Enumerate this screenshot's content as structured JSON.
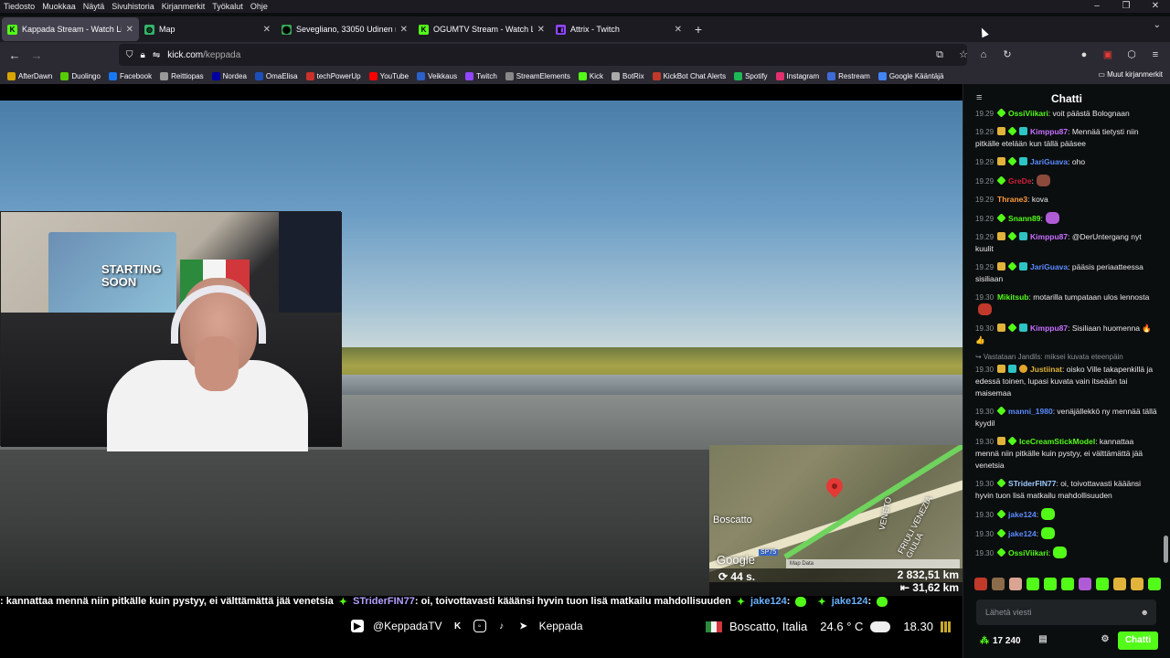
{
  "menubar": [
    "Tiedosto",
    "Muokkaa",
    "Näytä",
    "Sivuhistoria",
    "Kirjanmerkit",
    "Työkalut",
    "Ohje"
  ],
  "tabs": [
    {
      "label": "Kappada Stream - Watch Li",
      "icon": "kick-icon",
      "color": "#53fc18",
      "active": true
    },
    {
      "label": "Map",
      "icon": "globe-icon",
      "color": "#33b36b",
      "active": false
    },
    {
      "label": "Sevegliano, 33050 Udinen maakunta",
      "icon": "map-pin-icon",
      "color": "#34a853",
      "active": false
    },
    {
      "label": "OGUMTV Stream - Watch Li",
      "icon": "kick-icon",
      "color": "#53fc18",
      "active": false
    },
    {
      "label": "Attrix - Twitch",
      "icon": "twitch-icon",
      "color": "#9146ff",
      "active": false
    }
  ],
  "url": {
    "host": "kick.com",
    "path": "/keppada"
  },
  "bookmarks": [
    {
      "label": "AfterDawn",
      "color": "#d9a400"
    },
    {
      "label": "Duolingo",
      "color": "#58cc02"
    },
    {
      "label": "Facebook",
      "color": "#1877f2"
    },
    {
      "label": "Reittiopas",
      "color": "#999999"
    },
    {
      "label": "Nordea",
      "color": "#0000a0"
    },
    {
      "label": "OmaElisa",
      "color": "#1d4fb8"
    },
    {
      "label": "techPowerUp",
      "color": "#c9312a"
    },
    {
      "label": "YouTube",
      "color": "#ff0000"
    },
    {
      "label": "Veikkaus",
      "color": "#2a60c8"
    },
    {
      "label": "Twitch",
      "color": "#9146ff"
    },
    {
      "label": "StreamElements",
      "color": "#888888"
    },
    {
      "label": "Kick",
      "color": "#53fc18"
    },
    {
      "label": "BotRix",
      "color": "#aaaaaa"
    },
    {
      "label": "KickBot Chat Alerts",
      "color": "#c0392b"
    },
    {
      "label": "Spotify",
      "color": "#1db954"
    },
    {
      "label": "Instagram",
      "color": "#e1306c"
    },
    {
      "label": "Restream",
      "color": "#3e6bd8"
    },
    {
      "label": "Google Kääntäjä",
      "color": "#4285f4"
    }
  ],
  "other_bookmarks": "Muut kirjanmerkit",
  "webcam": {
    "poster_text": "STARTING SOON"
  },
  "map": {
    "place": "Boscatto",
    "road": "VENETO",
    "road2": "FRIULI VENEZIA GIULIA",
    "road_code": "SP75",
    "provider": "Google",
    "scale_label": "Map Data"
  },
  "stats": {
    "time": "⟳ 44 s.",
    "dist1": "2 832,51 km",
    "dist2": "⇤ 31,62 km"
  },
  "ticker": [
    {
      "text": ": kannattaa mennä niin pitkälle kuin pystyy, ei välttämättä jää venetsia",
      "kind": "text"
    },
    {
      "text": "STriderFIN77",
      "kind": "name"
    },
    {
      "text": ": oi, toivottavasti kääänsi hyvin tuon lisä matkailu mahdollisuuden",
      "kind": "text"
    },
    {
      "text": "jake124",
      "kind": "nm2"
    },
    {
      "text": ":",
      "kind": "text"
    },
    {
      "text": "jake124",
      "kind": "nm2"
    },
    {
      "text": ":",
      "kind": "text"
    }
  ],
  "social": {
    "youtube": "@KeppadaTV",
    "name": "Keppada"
  },
  "location": {
    "place": "Boscatto, Italia",
    "temp": "24.6 ° C",
    "clock": "18.30"
  },
  "chat": {
    "title": "Chatti",
    "messages": [
      {
        "time": "19.29",
        "badges": [
          "spark"
        ],
        "user": "OssiViikari",
        "color": "#53fc18",
        "text": ": voit päästä Bolognaan"
      },
      {
        "time": "19.29",
        "badges": [
          "crown",
          "spark",
          "gift"
        ],
        "user": "Kimppu87",
        "color": "#c770ff",
        "text": ": Mennää tietysti niin pitkälle etelään kun tällä pääsee"
      },
      {
        "time": "19.29",
        "badges": [
          "crown",
          "spark",
          "gift"
        ],
        "user": "JariGuava",
        "color": "#5b8bff",
        "text": ": oho"
      },
      {
        "time": "19.29",
        "badges": [
          "spark"
        ],
        "user": "GreDe",
        "color": "#d11f3a",
        "text": ":",
        "emote": "#8c4a3b"
      },
      {
        "time": "19.29",
        "badges": [],
        "user": "Thrane3",
        "color": "#ff9a3c",
        "text": ": kova"
      },
      {
        "time": "19.29",
        "badges": [
          "spark"
        ],
        "user": "Snann89",
        "color": "#53fc18",
        "text": ":",
        "emote": "#b05bd6"
      },
      {
        "time": "19.29",
        "badges": [
          "crown",
          "spark",
          "gift"
        ],
        "user": "Kimppu87",
        "color": "#c770ff",
        "text": ": @DerUntergang nyt kuulit"
      },
      {
        "time": "19.29",
        "badges": [
          "crown",
          "spark",
          "gift"
        ],
        "user": "JariGuava",
        "color": "#5b8bff",
        "text": ": pääsis periaatteessa sisiliaan"
      },
      {
        "time": "19.30",
        "badges": [],
        "user": "Mikitsub",
        "color": "#53fc18",
        "text": ": motarilla tumpataan ulos lennosta",
        "emote": "#c0392b"
      },
      {
        "time": "19.30",
        "badges": [
          "crown",
          "spark",
          "gift"
        ],
        "user": "Kimppu87",
        "color": "#c770ff",
        "text": ": Sisiliaan huomenna 🔥👍"
      },
      {
        "reply": "↪ Vastataan Jandils: miksei kuvata eteenpäin",
        "time": "19.30",
        "badges": [
          "crown",
          "gift",
          "sub"
        ],
        "user": "Justiinat",
        "color": "#e2b33b",
        "text": ": oisko Ville takapenkillä ja edessä toinen, lupasi kuvata vain itseään tai maisemaa"
      },
      {
        "time": "19.30",
        "badges": [
          "spark"
        ],
        "user": "manni_1980",
        "color": "#5b8bff",
        "text": ": venäjällekkö ny mennää tällä kyydil"
      },
      {
        "time": "19.30",
        "badges": [
          "crown",
          "spark"
        ],
        "user": "IceCreamStickModel",
        "color": "#53fc18",
        "text": ": kannattaa mennä niin pitkälle kuin pystyy, ei välttämättä jää venetsia"
      },
      {
        "time": "19.30",
        "badges": [
          "spark"
        ],
        "user": "STriderFIN77",
        "color": "#9ecbff",
        "text": ": oi, toivottavasti kääänsi hyvin tuon lisä matkailu mahdollisuuden"
      },
      {
        "time": "19.30",
        "badges": [
          "spark"
        ],
        "user": "jake124",
        "color": "#5b8bff",
        "text": ":",
        "emote": "#53fc18"
      },
      {
        "time": "19.30",
        "badges": [
          "spark"
        ],
        "user": "jake124",
        "color": "#5b8bff",
        "text": ":",
        "emote": "#53fc18"
      },
      {
        "time": "19.30",
        "badges": [
          "spark"
        ],
        "user": "OssiViikari",
        "color": "#53fc18",
        "text": ":",
        "emote": "#53fc18"
      }
    ],
    "emotes": [
      "#c0392b",
      "#8c6b4a",
      "#d9a592",
      "#53fc18",
      "#53fc18",
      "#53fc18",
      "#b05bd6",
      "#53fc18",
      "#e2b33b",
      "#e2b33b",
      "#53fc18"
    ],
    "input_placeholder": "Lähetä viesti",
    "viewers": "17 240",
    "send_label": "Chatti"
  }
}
